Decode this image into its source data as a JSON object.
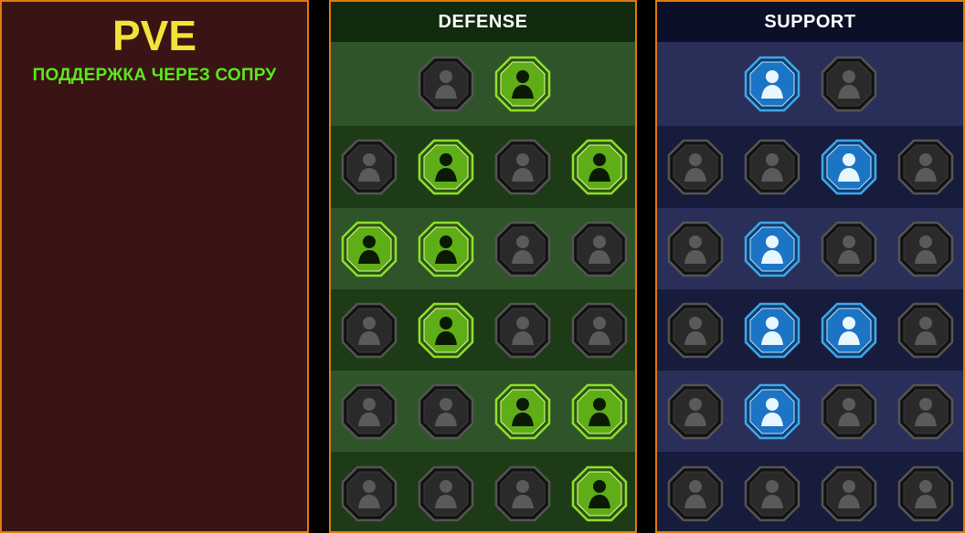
{
  "left_panel": {
    "title": "PVE",
    "subtitle": "ПОДДЕРЖКА ЧЕРЕЗ СОПРУ"
  },
  "colors": {
    "orange_border": "#e07a10",
    "title_yellow": "#f3e23a",
    "subtitle_green": "#59e81c",
    "defense_active": "#8fe02a",
    "support_active": "#3fa8e8",
    "inactive": "#2a2a2a"
  },
  "defense": {
    "title": "DEFENSE",
    "rows": [
      [
        {
          "name": "shield-tiles-icon",
          "active": false
        },
        {
          "name": "raised-fist-icon",
          "active": true
        }
      ],
      [
        {
          "name": "chevron-shield-icon",
          "active": false
        },
        {
          "name": "heart-hand-icon",
          "active": true
        },
        {
          "name": "stone-giant-icon",
          "active": false
        },
        {
          "name": "crossed-blades-icon",
          "active": true
        }
      ],
      [
        {
          "name": "dodge-fighter-icon",
          "active": true
        },
        {
          "name": "knight-shield-icon",
          "active": true
        },
        {
          "name": "dark-heart-icon",
          "active": false
        },
        {
          "name": "hooded-figure-icon",
          "active": false
        }
      ],
      [
        {
          "name": "crowd-icon",
          "active": false
        },
        {
          "name": "hourglass-skull-icon",
          "active": true
        },
        {
          "name": "open-hand-icon",
          "active": false
        },
        {
          "name": "bull-head-icon",
          "active": false
        }
      ],
      [
        {
          "name": "dash-runner-icon",
          "active": false
        },
        {
          "name": "claws-icon",
          "active": false
        },
        {
          "name": "sun-skull-icon",
          "active": true
        },
        {
          "name": "swift-strike-icon",
          "active": true
        }
      ],
      [
        {
          "name": "flame-warrior-icon",
          "active": false
        },
        {
          "name": "winged-shield-icon",
          "active": false
        },
        {
          "name": "burst-figure-icon",
          "active": false
        },
        {
          "name": "flexing-hero-icon",
          "active": true
        }
      ]
    ]
  },
  "support": {
    "title": "SUPPORT",
    "rows": [
      [
        {
          "name": "heart-plus-icon",
          "active": true
        },
        {
          "name": "slash-eye-icon",
          "active": false
        }
      ],
      [
        {
          "name": "praying-hands-icon",
          "active": false
        },
        {
          "name": "arc-shield-icon",
          "active": false
        },
        {
          "name": "flame-skull-icon",
          "active": true
        },
        {
          "name": "speed-lines-icon",
          "active": false
        }
      ],
      [
        {
          "name": "sparkle-figure-icon",
          "active": false
        },
        {
          "name": "lightning-icon",
          "active": true
        },
        {
          "name": "cracked-ground-icon",
          "active": false
        },
        {
          "name": "twin-figures-icon",
          "active": false
        }
      ],
      [
        {
          "name": "chained-heart-icon",
          "active": false
        },
        {
          "name": "meteor-icon",
          "active": true
        },
        {
          "name": "open-book-icon",
          "active": true
        },
        {
          "name": "angry-face-icon",
          "active": false
        }
      ],
      [
        {
          "name": "compass-star-icon",
          "active": false
        },
        {
          "name": "winged-boot-icon",
          "active": true
        },
        {
          "name": "watching-eye-icon",
          "active": false
        },
        {
          "name": "crossbones-figure-icon",
          "active": false
        }
      ],
      [
        {
          "name": "potion-skull-icon",
          "active": false
        },
        {
          "name": "horned-skull-icon",
          "active": false
        },
        {
          "name": "grasping-hand-icon",
          "active": false
        },
        {
          "name": "eagle-head-icon",
          "active": false
        }
      ]
    ]
  }
}
